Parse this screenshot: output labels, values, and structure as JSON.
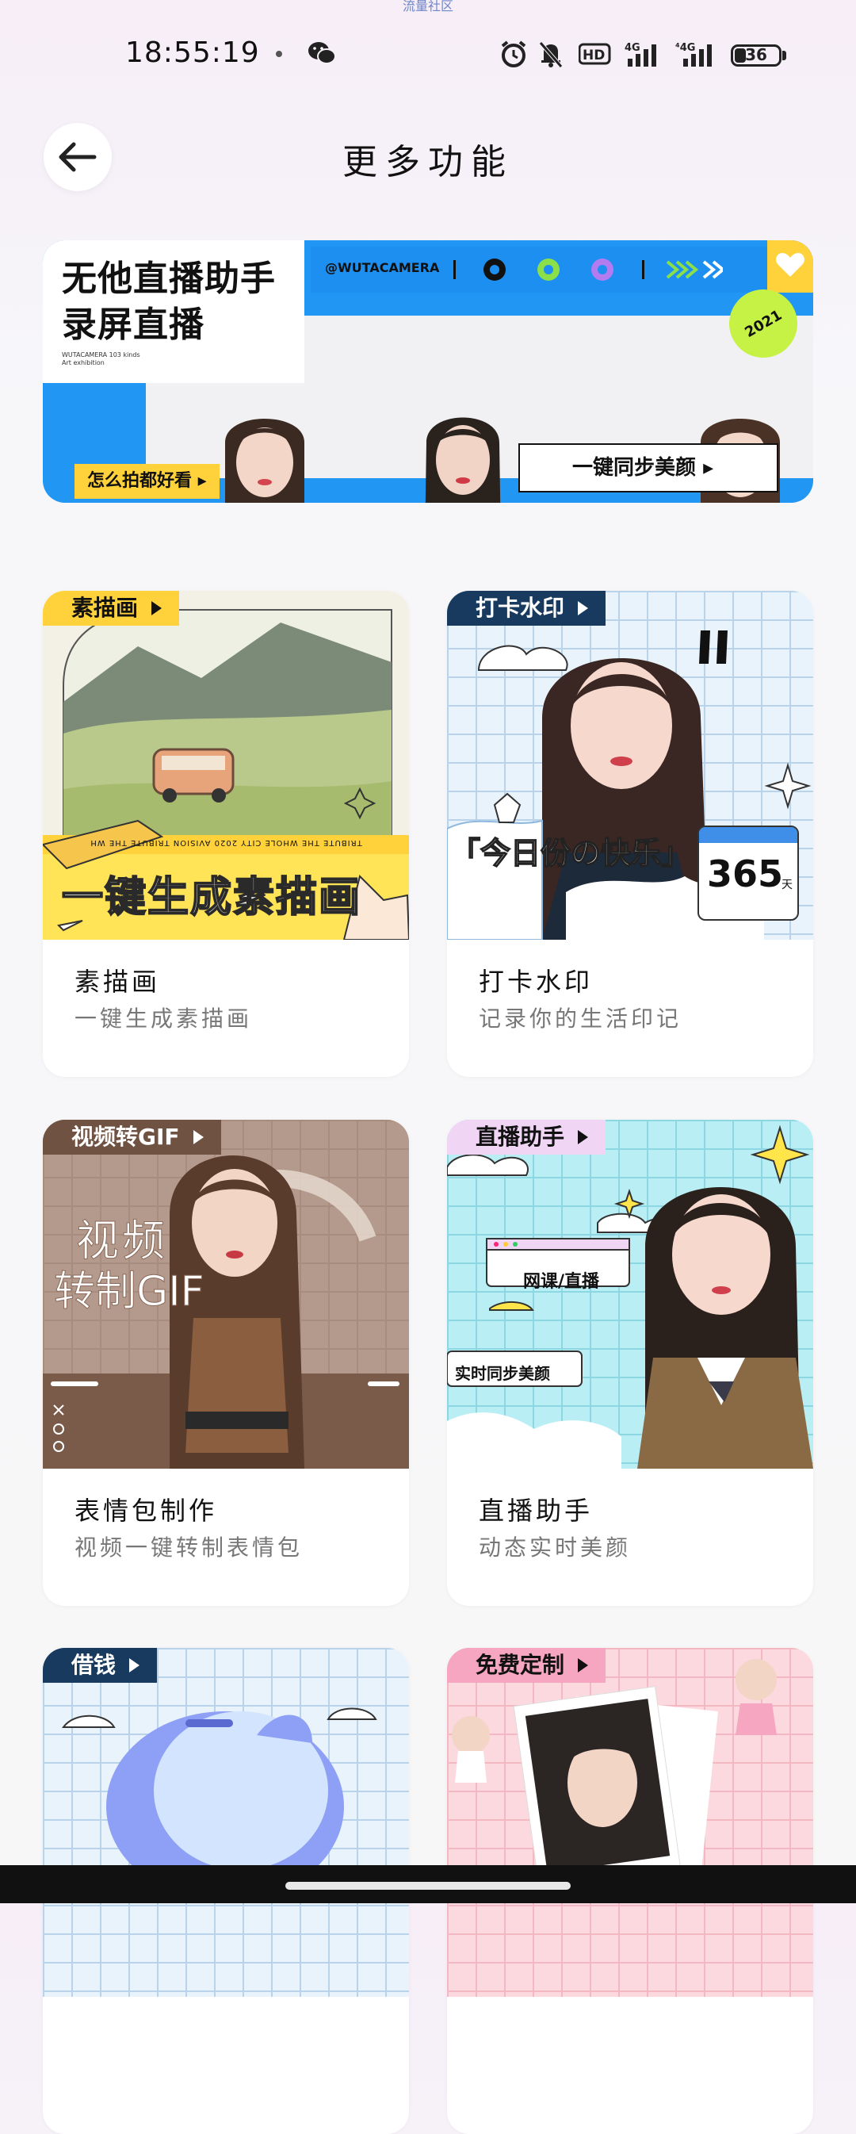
{
  "status_bar": {
    "top_hint": "流量社区",
    "time": "18:55:19",
    "battery": "36",
    "network": [
      "HD",
      "4G",
      "4G"
    ]
  },
  "header": {
    "title": "更多功能",
    "back_icon": "arrow-left-icon"
  },
  "banner": {
    "title_line1": "无他直播助手",
    "title_line2": "录屏直播",
    "small_text": "WUTACAMERA 103 kinds Art exhibition",
    "handle": "@WUTACAMERA",
    "badge": "2021",
    "howto_label": "怎么拍都好看",
    "sync_label": "一键同步美颜"
  },
  "cards": [
    {
      "tag": "素描画",
      "art_title": "一键生成素描画",
      "art_strip": "TRIBUTE THE WHOLE CITY   2020 AVISION   TRIBUTE THE WH",
      "name": "素描画",
      "desc": "一键生成素描画"
    },
    {
      "tag": "打卡水印",
      "art_title": "「今日份の快乐」",
      "art_day": "365",
      "art_day_unit": "天",
      "name": "打卡水印",
      "desc": "记录你的生活印记"
    },
    {
      "tag": "视频转GIF",
      "art_title_1": "视频",
      "art_title_2": "转制GIF",
      "name": "表情包制作",
      "desc": "视频一键转制表情包"
    },
    {
      "tag": "直播助手",
      "art_label_1": "网课/直播",
      "art_label_2": "实时同步美颜",
      "name": "直播助手",
      "desc": "动态实时美颜"
    },
    {
      "tag": "借钱"
    },
    {
      "tag": "免费定制"
    }
  ],
  "colors": {
    "banner_blue": "#2196f3",
    "yellow": "#ffd23b",
    "navy": "#173a5e",
    "lime": "#c6f246"
  }
}
